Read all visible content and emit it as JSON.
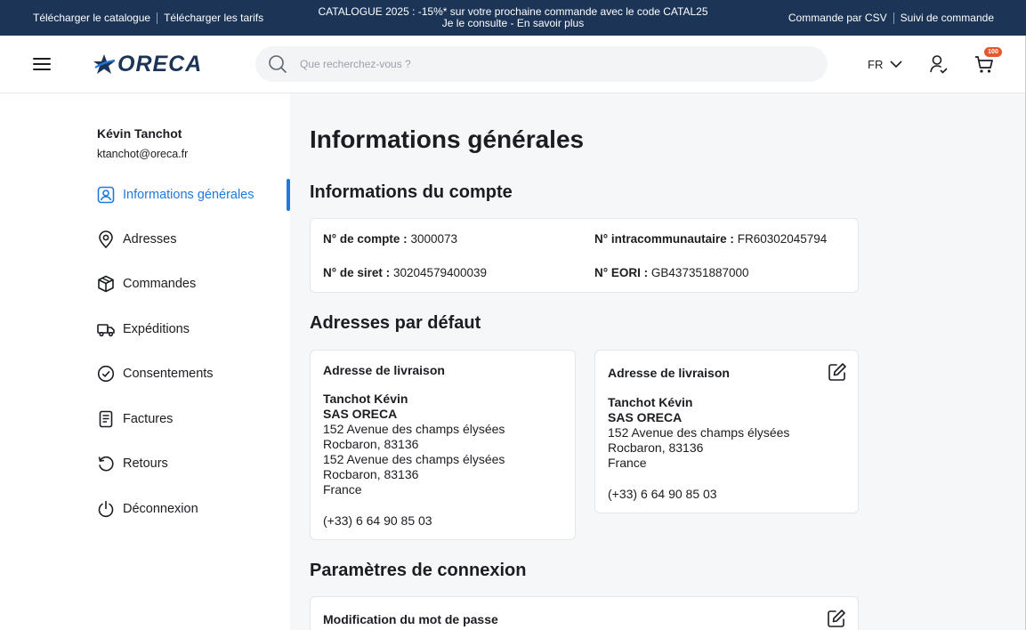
{
  "topbar": {
    "left_links": [
      "Télécharger le catalogue",
      "Télécharger les tarifs"
    ],
    "promo_line1": "CATALOGUE 2025 : -15%* sur votre prochaine commande avec le code CATAL25",
    "promo_line2": "Je le consulte - En savoir plus",
    "right_links": [
      "Commande par CSV",
      "Suivi de commande"
    ]
  },
  "header": {
    "logo_text": "ORECA",
    "search_placeholder": "Que recherchez-vous ?",
    "language": "FR",
    "cart_count": "100",
    "colors": {
      "brand": "#1c3557",
      "accent": "#1f7ae0",
      "badge": "#e5572e"
    }
  },
  "sidebar": {
    "user_name": "Kévin Tanchot",
    "user_email": "ktanchot@oreca.fr",
    "items": [
      {
        "label": "Informations générales",
        "icon": "user-card-icon",
        "active": true
      },
      {
        "label": "Adresses",
        "icon": "map-pin-icon",
        "active": false
      },
      {
        "label": "Commandes",
        "icon": "box-icon",
        "active": false
      },
      {
        "label": "Expéditions",
        "icon": "truck-icon",
        "active": false
      },
      {
        "label": "Consentements",
        "icon": "check-circle-icon",
        "active": false
      },
      {
        "label": "Factures",
        "icon": "invoice-icon",
        "active": false
      },
      {
        "label": "Retours",
        "icon": "return-icon",
        "active": false
      },
      {
        "label": "Déconnexion",
        "icon": "power-icon",
        "active": false
      }
    ]
  },
  "main": {
    "title": "Informations générales",
    "account": {
      "heading": "Informations du compte",
      "account_no_label": "N° de compte :",
      "account_no": "3000073",
      "intracom_label": "N° intracommunautaire :",
      "intracom": "FR60302045794",
      "siret_label": "N° de siret :",
      "siret": "30204579400039",
      "eori_label": "N° EORI :",
      "eori": "GB437351887000"
    },
    "addresses": {
      "heading": "Adresses par défaut",
      "left": {
        "title": "Adresse de livraison",
        "name": "Tanchot Kévin",
        "company": "SAS ORECA",
        "line1": "152 Avenue des champs élysées",
        "city1": "Rocbaron, 83136",
        "line2": "152 Avenue des champs élysées",
        "city2": "Rocbaron, 83136",
        "country": "France",
        "phone": "(+33) 6 64 90 85 03"
      },
      "right": {
        "title": "Adresse de livraison",
        "name": "Tanchot Kévin",
        "company": "SAS ORECA",
        "line1": "152 Avenue des champs élysées",
        "city1": "Rocbaron, 83136",
        "country": "France",
        "phone": "(+33) 6 64 90 85 03"
      }
    },
    "connection": {
      "heading": "Paramètres de connexion",
      "password_title": "Modification du mot de passe"
    }
  }
}
